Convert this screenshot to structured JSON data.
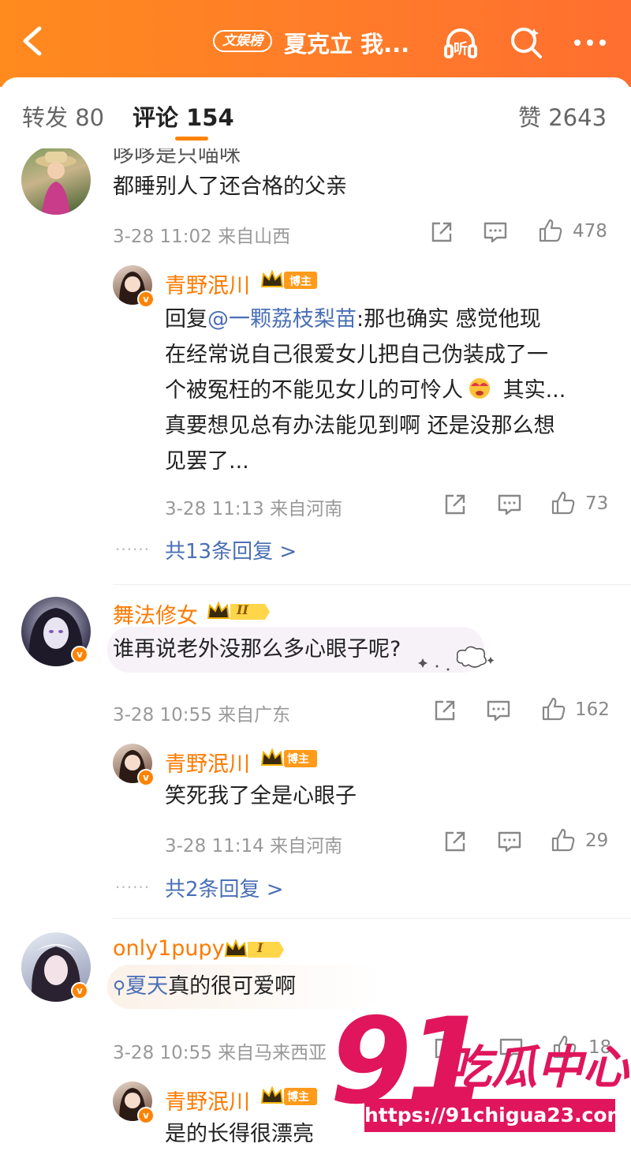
{
  "header": {
    "chip": "文娱榜",
    "title": "夏克立 我...",
    "accent": "#ff8200"
  },
  "tabs": {
    "repost": "转发 80",
    "comments": "评论 154",
    "likes": "赞 2643"
  },
  "comments": [
    {
      "name_partial": "哆哆是只喵咪",
      "text": "都睡别人了还合格的父亲",
      "meta": "3-28 11:02  来自山西",
      "likes": "478",
      "replies": [
        {
          "name": "青野泯川",
          "tag": "博主",
          "text_pre": "回复",
          "mention": "@一颗荔枝梨苗",
          "text_lines": [
            ":那也确实 感觉他现",
            "在经常说自己很爱女儿把自己伪装成了一",
            "个被冤枉的不能见女儿的可怜人",
            " 其实...",
            "真要想见总有办法能见到啊 还是没那么想",
            "见罢了..."
          ],
          "meta": "3-28 11:13  来自河南",
          "likes": "73"
        }
      ],
      "more": "共13条回复 >"
    },
    {
      "name": "舞法修女",
      "level": "II",
      "text": "谁再说老外没那么多心眼子呢?",
      "meta": "3-28 10:55  来自广东",
      "likes": "162",
      "replies": [
        {
          "name": "青野泯川",
          "tag": "博主",
          "text": "笑死我了全是心眼子",
          "meta": "3-28 11:14  来自河南",
          "likes": "29"
        }
      ],
      "more": "共2条回复 >"
    },
    {
      "name": "only1pupy",
      "level": "I",
      "search_word": "夏天",
      "text": "真的很可爱啊",
      "meta": "3-28 10:55  来自马来西亚",
      "likes": "18",
      "replies": [
        {
          "name": "青野泯川",
          "tag": "博主",
          "text": "是的长得很漂亮"
        }
      ]
    }
  ],
  "watermark": {
    "number": "91",
    "text": "吃瓜中心",
    "url": "https://91chigua23.com"
  }
}
